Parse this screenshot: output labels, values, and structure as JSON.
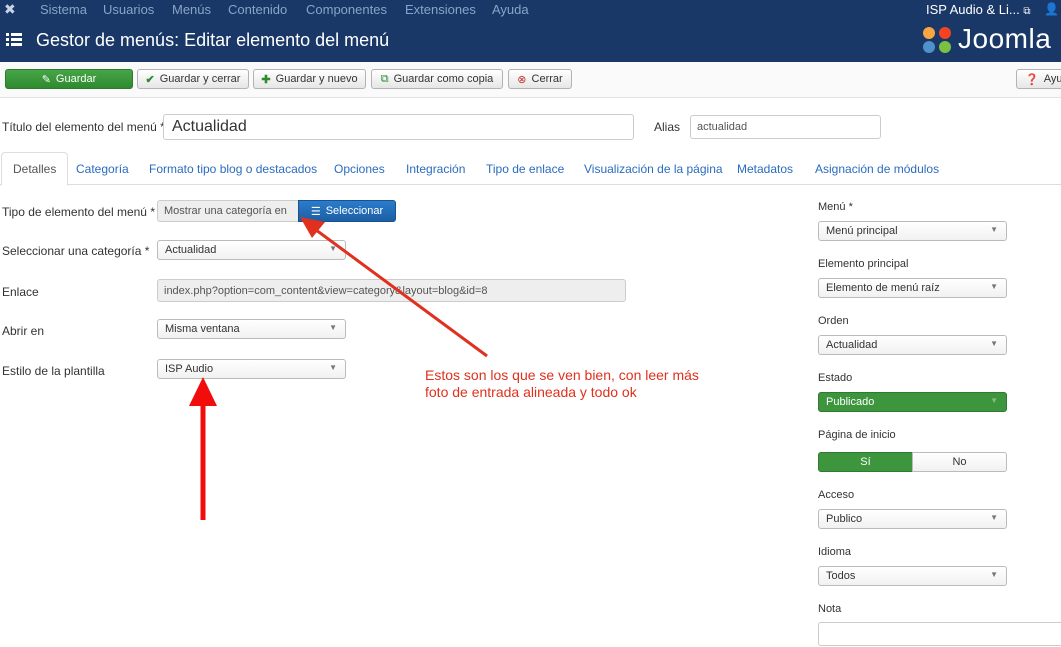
{
  "topbar": {
    "menus": [
      "Sistema",
      "Usuarios",
      "Menús",
      "Contenido",
      "Componentes",
      "Extensiones",
      "Ayuda"
    ],
    "site_link": "ISP Audio & Li...",
    "site_link_icon": "external-link-icon"
  },
  "header": {
    "title": "Gestor de menús: Editar elemento del menú",
    "brand": "Joomla"
  },
  "toolbar": {
    "save": "Guardar",
    "save_close": "Guardar y cerrar",
    "save_new": "Guardar y nuevo",
    "save_copy": "Guardar como copia",
    "close": "Cerrar",
    "help": "Ayu"
  },
  "form": {
    "title_label": "Título del elemento del menú *",
    "title_value": "Actualidad",
    "alias_label": "Alias",
    "alias_value": "actualidad"
  },
  "tabs": [
    "Detalles",
    "Categoría",
    "Formato tipo blog o destacados",
    "Opciones",
    "Integración",
    "Tipo de enlace",
    "Visualización de la página",
    "Metadatos",
    "Asignación de módulos"
  ],
  "details": {
    "type_label": "Tipo de elemento del menú *",
    "type_value": "Mostrar una categoría en",
    "select_button": "Seleccionar",
    "category_label": "Seleccionar una categoría *",
    "category_value": "Actualidad",
    "link_label": "Enlace",
    "link_value": "index.php?option=com_content&view=category&layout=blog&id=8",
    "open_label": "Abrir en",
    "open_value": "Misma ventana",
    "template_label": "Estilo de la plantilla",
    "template_value": "ISP Audio"
  },
  "sidebar": {
    "menu_label": "Menú *",
    "menu_value": "Menú principal",
    "parent_label": "Elemento principal",
    "parent_value": "Elemento de menú raíz",
    "order_label": "Orden",
    "order_value": "Actualidad",
    "status_label": "Estado",
    "status_value": "Publicado",
    "home_label": "Página de inicio",
    "home_yes": "Sí",
    "home_no": "No",
    "access_label": "Acceso",
    "access_value": "Publico",
    "language_label": "Idioma",
    "language_value": "Todos",
    "note_label": "Nota",
    "note_value": ""
  },
  "annotation": {
    "line1": "Estos son los que se ven bien, con leer más",
    "line2": "foto de entrada alineada y todo ok"
  },
  "colors": {
    "navbar": "#1a3867",
    "success": "#3d953d",
    "link": "#2a6cbf",
    "annotation": "#e0301e"
  }
}
